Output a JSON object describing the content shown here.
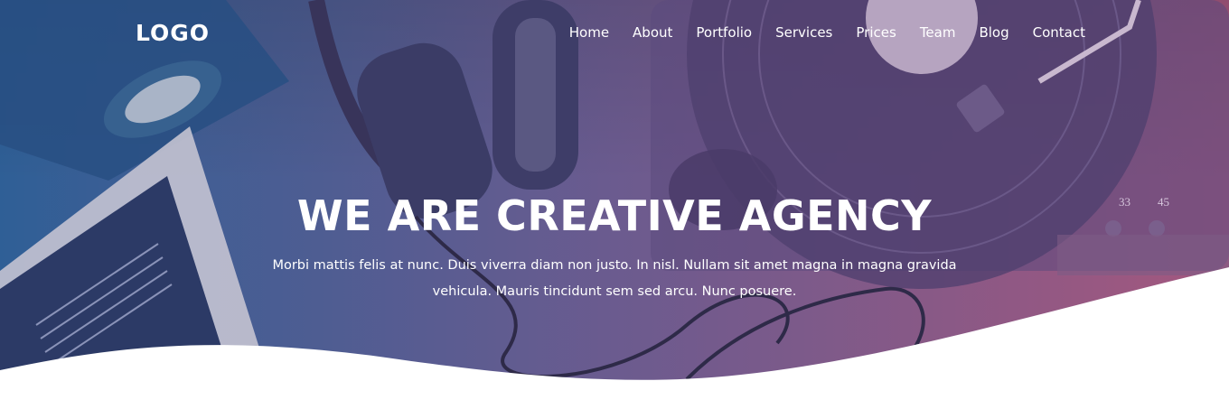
{
  "header": {
    "logo": "LOGO",
    "nav": [
      "Home",
      "About",
      "Portfolio",
      "Services",
      "Prices",
      "Team",
      "Blog",
      "Contact"
    ]
  },
  "hero": {
    "title": "WE ARE CREATIVE AGENCY",
    "subtitle": "Morbi mattis felis at nunc. Duis viverra diam non justo. In nisl. Nullam sit amet magna in magna gravida vehicula. Mauris tincidunt sem sed arcu. Nunc posuere.",
    "turntable_marks": [
      "33",
      "45"
    ]
  },
  "colors": {
    "gradient_start": "#2f5f96",
    "gradient_mid": "#6b5b8f",
    "gradient_end": "#a4577e",
    "wave": "#ffffff",
    "text": "#ffffff"
  }
}
